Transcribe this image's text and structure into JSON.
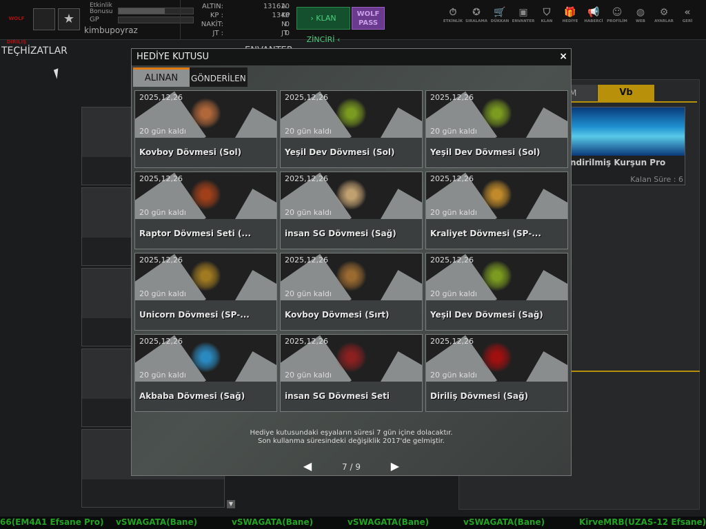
{
  "topbar": {
    "logo": "WOLF DIRILIŞ",
    "etkinlik_label": "Etkinlik Bonusu",
    "etkinlik_progress": 0.62,
    "gp_label": "GP",
    "gp_progress": 0,
    "username": "kimbupoyraz",
    "currencies": [
      {
        "key": "ALTIN:",
        "value": "131610",
        "unit": "A"
      },
      {
        "key": "KP :",
        "value": "1340",
        "unit": "KP"
      },
      {
        "key": "NAKİT:",
        "value": "0",
        "unit": "N"
      },
      {
        "key": "JT :",
        "value": "0",
        "unit": "JT"
      }
    ],
    "klan_zinciri": "› KLAN ZİNCİRİ ‹",
    "wolf_pass": "WOLF PASS",
    "nav": [
      {
        "label": "ETKİNLİK",
        "icon": "stopwatch-icon",
        "glyph": "⏱"
      },
      {
        "label": "SIRALAMA",
        "icon": "medal-icon",
        "glyph": "✪"
      },
      {
        "label": "DÜKKAN",
        "icon": "cart-icon",
        "glyph": "🛒"
      },
      {
        "label": "ENVANTER",
        "icon": "chest-icon",
        "glyph": "▣"
      },
      {
        "label": "KLAN",
        "icon": "shield-icon",
        "glyph": "⛉"
      },
      {
        "label": "HEDİYE",
        "icon": "gift-icon",
        "glyph": "🎁"
      },
      {
        "label": "HABERCİ",
        "icon": "megaphone-icon",
        "glyph": "📢"
      },
      {
        "label": "PROFİLİM",
        "icon": "profile-icon",
        "glyph": "☺"
      },
      {
        "label": "WEB",
        "icon": "globe-icon",
        "glyph": "◍"
      },
      {
        "label": "AYARLAR",
        "icon": "gear-icon",
        "glyph": "⚙"
      },
      {
        "label": "GERİ",
        "icon": "back-icon",
        "glyph": "«"
      }
    ]
  },
  "background": {
    "left_title": "TEÇHİZATLAR",
    "inventory_title": "ENVANTER",
    "tab_m": "M",
    "tab_vb": "Vb",
    "item_name": "ndirilmiş Kurşun Pro",
    "item_remaining": "Kalan Süre : 6"
  },
  "modal": {
    "title": "HEDİYE KUTUSU",
    "close": "×",
    "tabs": [
      "ALINAN",
      "GÖNDERİLEN"
    ],
    "items": [
      {
        "date": "2025,12,26",
        "remaining": "20 gün kaldı",
        "name": "Kovboy Dövmesi (Sol)",
        "color": "#b0683a"
      },
      {
        "date": "2025,12,26",
        "remaining": "20 gün kaldı",
        "name": "Yeşil Dev Dövmesi (Sol)",
        "color": "#7a9a20"
      },
      {
        "date": "2025,12,26",
        "remaining": "20 gün kaldı",
        "name": "Yeşil Dev Dövmesi (Sol)",
        "color": "#7a9a20"
      },
      {
        "date": "2025,12,26",
        "remaining": "20 gün kaldı",
        "name": "Raptor Dövmesi Seti (...",
        "color": "#a0401a"
      },
      {
        "date": "2025,12,26",
        "remaining": "20 gün kaldı",
        "name": "insan SG Dövmesi (Sağ)",
        "color": "#c0a070"
      },
      {
        "date": "2025,12,26",
        "remaining": "20 gün kaldı",
        "name": "Kraliyet Dövmesi (SP-...",
        "color": "#c08a2a"
      },
      {
        "date": "2025,12,26",
        "remaining": "20 gün kaldı",
        "name": "Unicorn Dövmesi (SP-...",
        "color": "#a07a20"
      },
      {
        "date": "2025,12,26",
        "remaining": "20 gün kaldı",
        "name": "Kovboy Dövmesi (Sırt)",
        "color": "#9a6a30"
      },
      {
        "date": "2025,12,26",
        "remaining": "20 gün kaldı",
        "name": "Yeşil Dev Dövmesi (Sağ)",
        "color": "#7a9a20"
      },
      {
        "date": "2025,12,26",
        "remaining": "20 gün kaldı",
        "name": "Akbaba Dövmesi (Sağ)",
        "color": "#2a8ac0"
      },
      {
        "date": "2025,12,26",
        "remaining": "20 gün kaldı",
        "name": "insan SG Dövmesi Seti",
        "color": "#8a2020"
      },
      {
        "date": "2025,12,26",
        "remaining": "20 gün kaldı",
        "name": "Diriliş Dövmesi (Sağ)",
        "color": "#a01010"
      }
    ],
    "note_line1": "Hediye kutusundaki eşyaların süresi 7 gün içine dolacaktır.",
    "note_line2": "Son kullanma süresindeki değişiklik 2017'de gelmiştir.",
    "prev": "◀",
    "next": "▶",
    "page": "7 / 9"
  },
  "ticker": [
    "66(EM4A1 Efsane Pro)",
    "vSWAGATA(Bane)",
    "vSWAGATA(Bane)",
    "vSWAGATA(Bane)",
    "vSWAGATA(Bane)",
    "KirveMRB(UZAS-12 Efsane)"
  ]
}
